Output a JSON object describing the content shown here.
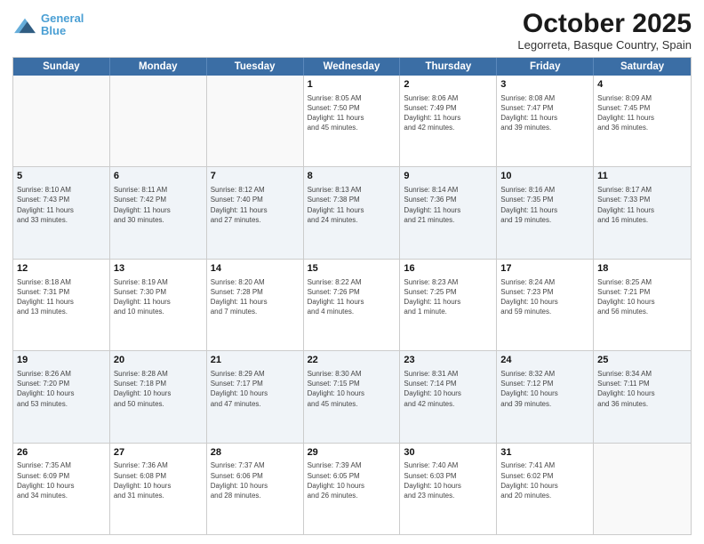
{
  "header": {
    "logo_line1": "General",
    "logo_line2": "Blue",
    "month": "October 2025",
    "location": "Legorreta, Basque Country, Spain"
  },
  "weekdays": [
    "Sunday",
    "Monday",
    "Tuesday",
    "Wednesday",
    "Thursday",
    "Friday",
    "Saturday"
  ],
  "weeks": [
    [
      {
        "day": "",
        "info": ""
      },
      {
        "day": "",
        "info": ""
      },
      {
        "day": "",
        "info": ""
      },
      {
        "day": "1",
        "info": "Sunrise: 8:05 AM\nSunset: 7:50 PM\nDaylight: 11 hours\nand 45 minutes."
      },
      {
        "day": "2",
        "info": "Sunrise: 8:06 AM\nSunset: 7:49 PM\nDaylight: 11 hours\nand 42 minutes."
      },
      {
        "day": "3",
        "info": "Sunrise: 8:08 AM\nSunset: 7:47 PM\nDaylight: 11 hours\nand 39 minutes."
      },
      {
        "day": "4",
        "info": "Sunrise: 8:09 AM\nSunset: 7:45 PM\nDaylight: 11 hours\nand 36 minutes."
      }
    ],
    [
      {
        "day": "5",
        "info": "Sunrise: 8:10 AM\nSunset: 7:43 PM\nDaylight: 11 hours\nand 33 minutes."
      },
      {
        "day": "6",
        "info": "Sunrise: 8:11 AM\nSunset: 7:42 PM\nDaylight: 11 hours\nand 30 minutes."
      },
      {
        "day": "7",
        "info": "Sunrise: 8:12 AM\nSunset: 7:40 PM\nDaylight: 11 hours\nand 27 minutes."
      },
      {
        "day": "8",
        "info": "Sunrise: 8:13 AM\nSunset: 7:38 PM\nDaylight: 11 hours\nand 24 minutes."
      },
      {
        "day": "9",
        "info": "Sunrise: 8:14 AM\nSunset: 7:36 PM\nDaylight: 11 hours\nand 21 minutes."
      },
      {
        "day": "10",
        "info": "Sunrise: 8:16 AM\nSunset: 7:35 PM\nDaylight: 11 hours\nand 19 minutes."
      },
      {
        "day": "11",
        "info": "Sunrise: 8:17 AM\nSunset: 7:33 PM\nDaylight: 11 hours\nand 16 minutes."
      }
    ],
    [
      {
        "day": "12",
        "info": "Sunrise: 8:18 AM\nSunset: 7:31 PM\nDaylight: 11 hours\nand 13 minutes."
      },
      {
        "day": "13",
        "info": "Sunrise: 8:19 AM\nSunset: 7:30 PM\nDaylight: 11 hours\nand 10 minutes."
      },
      {
        "day": "14",
        "info": "Sunrise: 8:20 AM\nSunset: 7:28 PM\nDaylight: 11 hours\nand 7 minutes."
      },
      {
        "day": "15",
        "info": "Sunrise: 8:22 AM\nSunset: 7:26 PM\nDaylight: 11 hours\nand 4 minutes."
      },
      {
        "day": "16",
        "info": "Sunrise: 8:23 AM\nSunset: 7:25 PM\nDaylight: 11 hours\nand 1 minute."
      },
      {
        "day": "17",
        "info": "Sunrise: 8:24 AM\nSunset: 7:23 PM\nDaylight: 10 hours\nand 59 minutes."
      },
      {
        "day": "18",
        "info": "Sunrise: 8:25 AM\nSunset: 7:21 PM\nDaylight: 10 hours\nand 56 minutes."
      }
    ],
    [
      {
        "day": "19",
        "info": "Sunrise: 8:26 AM\nSunset: 7:20 PM\nDaylight: 10 hours\nand 53 minutes."
      },
      {
        "day": "20",
        "info": "Sunrise: 8:28 AM\nSunset: 7:18 PM\nDaylight: 10 hours\nand 50 minutes."
      },
      {
        "day": "21",
        "info": "Sunrise: 8:29 AM\nSunset: 7:17 PM\nDaylight: 10 hours\nand 47 minutes."
      },
      {
        "day": "22",
        "info": "Sunrise: 8:30 AM\nSunset: 7:15 PM\nDaylight: 10 hours\nand 45 minutes."
      },
      {
        "day": "23",
        "info": "Sunrise: 8:31 AM\nSunset: 7:14 PM\nDaylight: 10 hours\nand 42 minutes."
      },
      {
        "day": "24",
        "info": "Sunrise: 8:32 AM\nSunset: 7:12 PM\nDaylight: 10 hours\nand 39 minutes."
      },
      {
        "day": "25",
        "info": "Sunrise: 8:34 AM\nSunset: 7:11 PM\nDaylight: 10 hours\nand 36 minutes."
      }
    ],
    [
      {
        "day": "26",
        "info": "Sunrise: 7:35 AM\nSunset: 6:09 PM\nDaylight: 10 hours\nand 34 minutes."
      },
      {
        "day": "27",
        "info": "Sunrise: 7:36 AM\nSunset: 6:08 PM\nDaylight: 10 hours\nand 31 minutes."
      },
      {
        "day": "28",
        "info": "Sunrise: 7:37 AM\nSunset: 6:06 PM\nDaylight: 10 hours\nand 28 minutes."
      },
      {
        "day": "29",
        "info": "Sunrise: 7:39 AM\nSunset: 6:05 PM\nDaylight: 10 hours\nand 26 minutes."
      },
      {
        "day": "30",
        "info": "Sunrise: 7:40 AM\nSunset: 6:03 PM\nDaylight: 10 hours\nand 23 minutes."
      },
      {
        "day": "31",
        "info": "Sunrise: 7:41 AM\nSunset: 6:02 PM\nDaylight: 10 hours\nand 20 minutes."
      },
      {
        "day": "",
        "info": ""
      }
    ]
  ]
}
